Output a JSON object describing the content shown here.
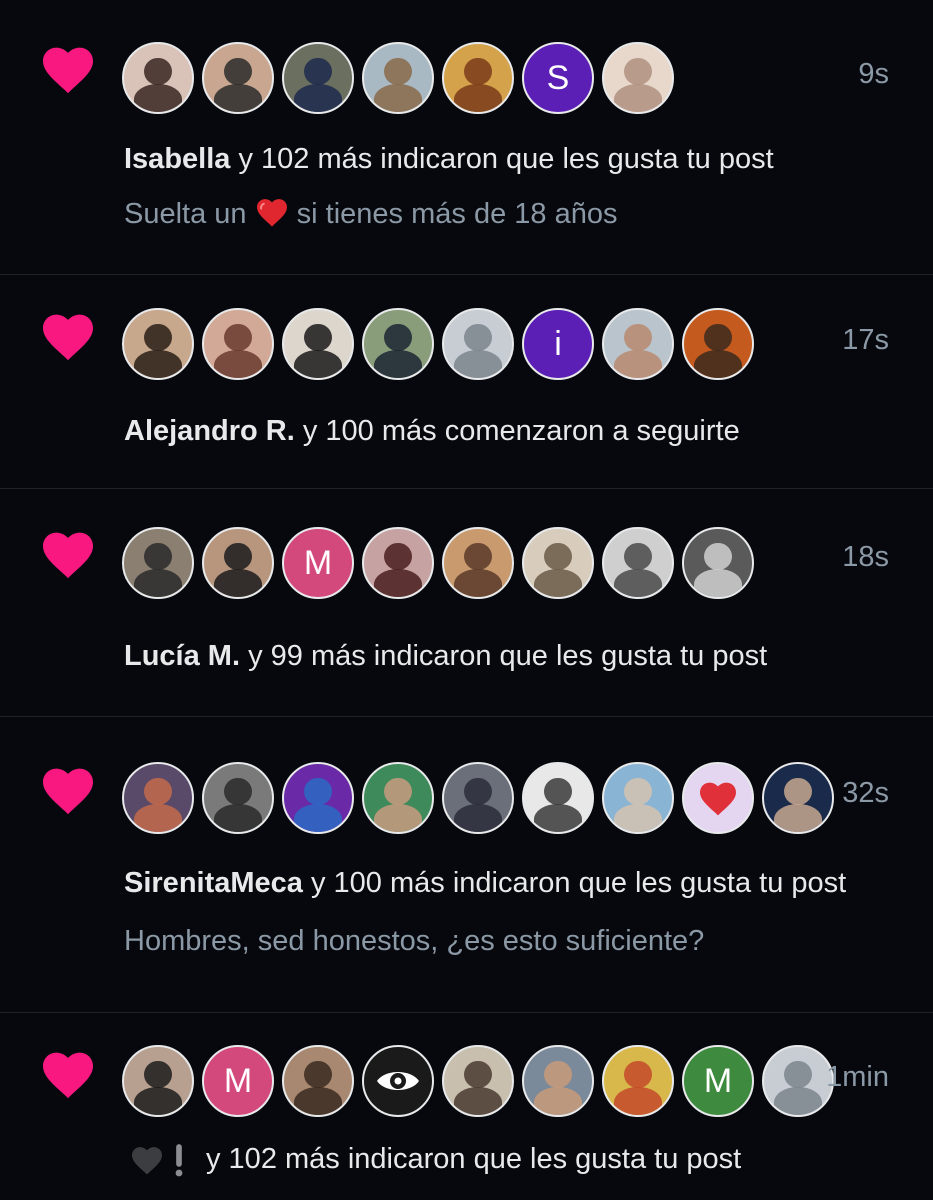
{
  "colors": {
    "background": "#06080d",
    "like_heart": "#f91880",
    "text_primary": "#e7e9ea",
    "text_secondary": "#8b98a5",
    "divider": "#1f2328"
  },
  "notifications": [
    {
      "icon": "heart-icon",
      "time": "9s",
      "name": "Isabella",
      "action": " y 102 más indicaron que les gusta tu post",
      "preview_before": "Suelta un ",
      "preview_after": " si tienes más de 18 años",
      "avatars": [
        {
          "type": "photo",
          "bg": "#d9c3b8",
          "fg": "#3a2722"
        },
        {
          "type": "photo",
          "bg": "#c8a690",
          "fg": "#2c2c2c"
        },
        {
          "type": "photo",
          "bg": "#6b6f5f",
          "fg": "#1d2a4d"
        },
        {
          "type": "photo",
          "bg": "#a9b9c4",
          "fg": "#8a6a4a"
        },
        {
          "type": "photo",
          "bg": "#d4a24a",
          "fg": "#7a3c1a"
        },
        {
          "type": "letter",
          "bg": "#5b1fb5",
          "letter": "S"
        },
        {
          "type": "photo",
          "bg": "#e8d8cc",
          "fg": "#b09080"
        }
      ]
    },
    {
      "icon": "heart-icon",
      "time": "17s",
      "name": "Alejandro R.",
      "action": " y 100 más comenzaron a seguirte",
      "avatars": [
        {
          "type": "photo",
          "bg": "#c7a88d",
          "fg": "#2a1e18"
        },
        {
          "type": "photo",
          "bg": "#d2a897",
          "fg": "#6a3a2e"
        },
        {
          "type": "photo",
          "bg": "#dcd6cc",
          "fg": "#1a1a1a"
        },
        {
          "type": "photo",
          "bg": "#8a9d7a",
          "fg": "#1b2634"
        },
        {
          "type": "default",
          "bg": "#c7cdd3",
          "fg": "#7d858c"
        },
        {
          "type": "letter",
          "bg": "#5b1fb5",
          "letter": "i"
        },
        {
          "type": "photo",
          "bg": "#b9c4cc",
          "fg": "#b88a6e"
        },
        {
          "type": "photo",
          "bg": "#c45a1e",
          "fg": "#3b2a1e"
        }
      ]
    },
    {
      "icon": "heart-icon",
      "time": "18s",
      "name": "Lucía M.",
      "action": " y 99 más indicaron que les gusta tu post",
      "avatars": [
        {
          "type": "photo",
          "bg": "#8a7f70",
          "fg": "#2a2a2a"
        },
        {
          "type": "photo",
          "bg": "#b7967d",
          "fg": "#1c1c1c"
        },
        {
          "type": "letter",
          "bg": "#d4497c",
          "letter": "M"
        },
        {
          "type": "photo",
          "bg": "#c6a2a2",
          "fg": "#4a1e1e"
        },
        {
          "type": "photo",
          "bg": "#c89a6e",
          "fg": "#5a3a2a"
        },
        {
          "type": "photo",
          "bg": "#d8cdbd",
          "fg": "#6a5a48"
        },
        {
          "type": "photo",
          "bg": "#cfcfcf",
          "fg": "#4a4a4a"
        },
        {
          "type": "photo",
          "bg": "#5a5a5a",
          "fg": "#d0d0d0"
        }
      ]
    },
    {
      "icon": "heart-icon",
      "time": "32s",
      "name": "SirenitaMeca",
      "action": " y 100 más indicaron que les gusta tu post",
      "preview": "Hombres, sed honestos, ¿es esto suficiente?",
      "avatars": [
        {
          "type": "photo",
          "bg": "#5a4a6a",
          "fg": "#c46a4a"
        },
        {
          "type": "photo",
          "bg": "#7a7a7a",
          "fg": "#2a2a2a"
        },
        {
          "type": "photo",
          "bg": "#6a2aa8",
          "fg": "#2a6ac4"
        },
        {
          "type": "photo",
          "bg": "#3f8a5a",
          "fg": "#c89a80"
        },
        {
          "type": "photo",
          "bg": "#6a6f7a",
          "fg": "#2a2e3a"
        },
        {
          "type": "photo",
          "bg": "#e8e8e8",
          "fg": "#3a3a3a"
        },
        {
          "type": "photo",
          "bg": "#8ab4d4",
          "fg": "#d4c2b0"
        },
        {
          "type": "heart",
          "bg": "#e4d6f0",
          "fg": "#e0303a"
        },
        {
          "type": "photo",
          "bg": "#1a2a4a",
          "fg": "#c8a890"
        }
      ]
    },
    {
      "icon": "heart-icon",
      "time": "1min",
      "prefix_icons": [
        "black-heart-icon",
        "exclamation-icon"
      ],
      "action": "y 102 más indicaron que les gusta tu post",
      "avatars": [
        {
          "type": "photo",
          "bg": "#b8a090",
          "fg": "#1c1c1c"
        },
        {
          "type": "letter",
          "bg": "#d4497c",
          "letter": "M"
        },
        {
          "type": "photo",
          "bg": "#a88870",
          "fg": "#3a2a20"
        },
        {
          "type": "eye",
          "bg": "#1a1a1a",
          "fg": "#ffffff"
        },
        {
          "type": "photo",
          "bg": "#c8bfae",
          "fg": "#4a3a30"
        },
        {
          "type": "photo",
          "bg": "#7a8a9a",
          "fg": "#c89a7a"
        },
        {
          "type": "photo",
          "bg": "#d8b84a",
          "fg": "#c44a2a"
        },
        {
          "type": "letter",
          "bg": "#3e8a3e",
          "letter": "M"
        },
        {
          "type": "default",
          "bg": "#c7cdd3",
          "fg": "#7d858c"
        }
      ]
    }
  ]
}
